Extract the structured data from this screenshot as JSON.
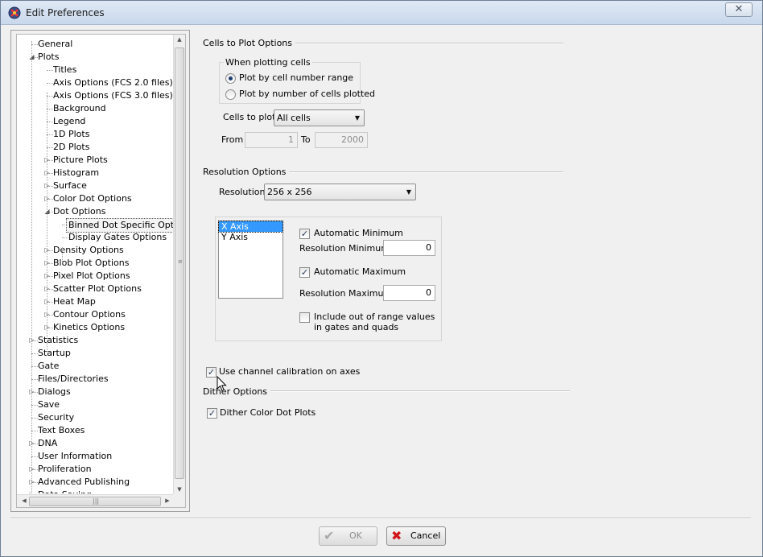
{
  "window": {
    "title": "Edit Preferences",
    "close_glyph": "✕"
  },
  "tree": {
    "items": [
      {
        "label": "General",
        "level": 0,
        "expander": "none"
      },
      {
        "label": "Plots",
        "level": 0,
        "expander": "expanded"
      },
      {
        "label": "Titles",
        "level": 1,
        "expander": "none"
      },
      {
        "label": "Axis Options (FCS 2.0 files)",
        "level": 1,
        "expander": "none"
      },
      {
        "label": "Axis Options (FCS 3.0 files)",
        "level": 1,
        "expander": "none"
      },
      {
        "label": "Background",
        "level": 1,
        "expander": "none"
      },
      {
        "label": "Legend",
        "level": 1,
        "expander": "none"
      },
      {
        "label": "1D Plots",
        "level": 1,
        "expander": "none"
      },
      {
        "label": "2D Plots",
        "level": 1,
        "expander": "none"
      },
      {
        "label": "Picture Plots",
        "level": 1,
        "expander": "collapsed"
      },
      {
        "label": "Histogram",
        "level": 1,
        "expander": "collapsed"
      },
      {
        "label": "Surface",
        "level": 1,
        "expander": "collapsed"
      },
      {
        "label": "Color Dot Options",
        "level": 1,
        "expander": "collapsed"
      },
      {
        "label": "Dot Options",
        "level": 1,
        "expander": "expanded"
      },
      {
        "label": "Binned Dot Specific Options",
        "level": 2,
        "expander": "none",
        "selected": true
      },
      {
        "label": "Display Gates Options",
        "level": 2,
        "expander": "none"
      },
      {
        "label": "Density Options",
        "level": 1,
        "expander": "collapsed"
      },
      {
        "label": "Blob Plot Options",
        "level": 1,
        "expander": "collapsed"
      },
      {
        "label": "Pixel Plot Options",
        "level": 1,
        "expander": "collapsed"
      },
      {
        "label": "Scatter Plot Options",
        "level": 1,
        "expander": "collapsed"
      },
      {
        "label": "Heat Map",
        "level": 1,
        "expander": "collapsed"
      },
      {
        "label": "Contour Options",
        "level": 1,
        "expander": "collapsed"
      },
      {
        "label": "Kinetics Options",
        "level": 1,
        "expander": "collapsed"
      },
      {
        "label": "Statistics",
        "level": 0,
        "expander": "collapsed"
      },
      {
        "label": "Startup",
        "level": 0,
        "expander": "none"
      },
      {
        "label": "Gate",
        "level": 0,
        "expander": "none"
      },
      {
        "label": "Files/Directories",
        "level": 0,
        "expander": "none"
      },
      {
        "label": "Dialogs",
        "level": 0,
        "expander": "collapsed"
      },
      {
        "label": "Save",
        "level": 0,
        "expander": "none"
      },
      {
        "label": "Security",
        "level": 0,
        "expander": "none"
      },
      {
        "label": "Text Boxes",
        "level": 0,
        "expander": "none"
      },
      {
        "label": "DNA",
        "level": 0,
        "expander": "collapsed"
      },
      {
        "label": "User Information",
        "level": 0,
        "expander": "none"
      },
      {
        "label": "Proliferation",
        "level": 0,
        "expander": "collapsed"
      },
      {
        "label": "Advanced Publishing",
        "level": 0,
        "expander": "collapsed"
      },
      {
        "label": "Data Saving",
        "level": 0,
        "expander": "collapsed"
      }
    ]
  },
  "cells_to_plot": {
    "group_title": "Cells to Plot Options",
    "when_plotting_label": "When plotting cells",
    "radio_range": "Plot by cell number range",
    "radio_number": "Plot by number of cells plotted",
    "selected_radio": "range",
    "cells_label": "Cells to plot",
    "cells_value": "All cells",
    "from_label": "From",
    "from_value": "1",
    "to_label": "To",
    "to_value": "2000"
  },
  "resolution": {
    "group_title": "Resolution Options",
    "resolution_label": "Resolution",
    "resolution_value": "256 x 256",
    "axes": [
      "X Axis",
      "Y Axis"
    ],
    "selected_axis": "X Axis",
    "auto_min_label": "Automatic Minimum",
    "auto_min_checked": true,
    "res_min_label": "Resolution Minimum",
    "res_min_value": "0",
    "auto_max_label": "Automatic Maximum",
    "auto_max_checked": true,
    "res_max_label": "Resolution Maximum",
    "res_max_value": "0",
    "include_label_line1": "Include out of range values",
    "include_label_line2": "in gates and quads",
    "include_checked": false
  },
  "calibration": {
    "label": "Use channel calibration on axes",
    "checked": true
  },
  "dither": {
    "group_title": "Dither Options",
    "label": "Dither Color Dot Plots",
    "checked": true
  },
  "buttons": {
    "ok": "OK",
    "cancel": "Cancel"
  }
}
